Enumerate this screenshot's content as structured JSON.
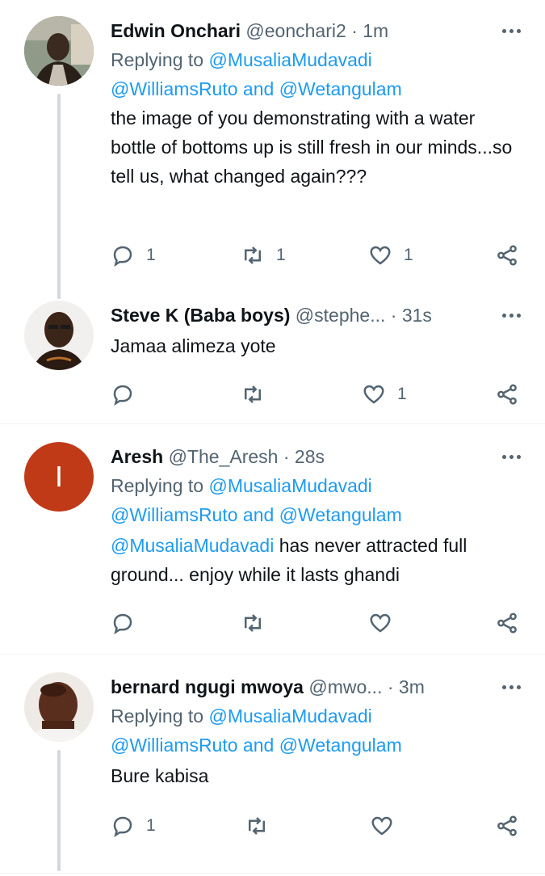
{
  "tweets": [
    {
      "name": "Edwin Onchari",
      "handle": "@eonchari2",
      "dot": "·",
      "time": "1m",
      "replying_prefix": "Replying to",
      "replying_to_1": "@MusaliaMudavadi",
      "replying_to_2": "@WilliamsRuto",
      "replying_and": "and",
      "replying_to_3": "@Wetangulam",
      "text": "the image of you demonstrating with a water bottle of bottoms up is still fresh in our minds...so tell us, what changed again???",
      "reply_count": "1",
      "retweet_count": "1",
      "like_count": "1"
    },
    {
      "name": "Steve K (Baba boys)",
      "handle": "@stephe...",
      "dot": "·",
      "time": "31s",
      "text": "Jamaa alimeza yote",
      "reply_count": "",
      "retweet_count": "",
      "like_count": "1"
    },
    {
      "name": "Aresh",
      "handle": "@The_Aresh",
      "dot": "·",
      "time": "28s",
      "avatar_letter": "I",
      "avatar_color": "#c13a17",
      "replying_prefix": "Replying to",
      "replying_to_1": "@MusaliaMudavadi",
      "replying_to_2": "@WilliamsRuto",
      "replying_and": "and",
      "replying_to_3": "@Wetangulam",
      "text_mention": "@MusaliaMudavadi",
      "text": " has never attracted full ground... enjoy while it lasts ghandi",
      "reply_count": "",
      "retweet_count": "",
      "like_count": ""
    },
    {
      "name": "bernard ngugi mwoya",
      "handle": "@mwo...",
      "dot": "·",
      "time": "3m",
      "replying_prefix": "Replying to",
      "replying_to_1": "@MusaliaMudavadi",
      "replying_to_2": "@WilliamsRuto",
      "replying_and": "and",
      "replying_to_3": "@Wetangulam",
      "text": "Bure kabisa",
      "reply_count": "1",
      "retweet_count": "",
      "like_count": ""
    }
  ],
  "icons": {
    "reply": "reply-icon",
    "retweet": "retweet-icon",
    "like": "heart-icon",
    "share": "share-icon",
    "more": "more-icon"
  },
  "colors": {
    "link": "#1d9bf0",
    "muted": "#536471",
    "text": "#0f1419",
    "thread_line": "#cfd9de"
  }
}
